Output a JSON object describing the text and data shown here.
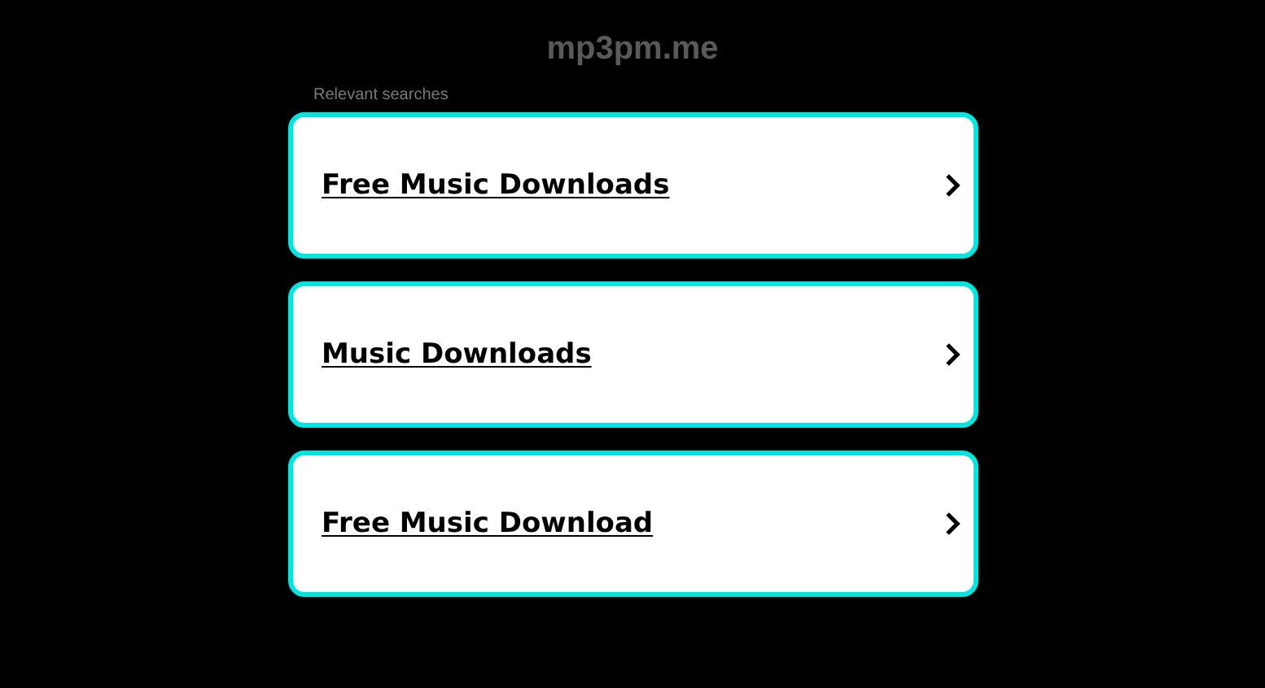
{
  "site_title": "mp3pm.me",
  "section_label": "Relevant searches",
  "links": [
    {
      "label": "Free Music Downloads"
    },
    {
      "label": "Music Downloads"
    },
    {
      "label": "Free Music Download"
    }
  ]
}
